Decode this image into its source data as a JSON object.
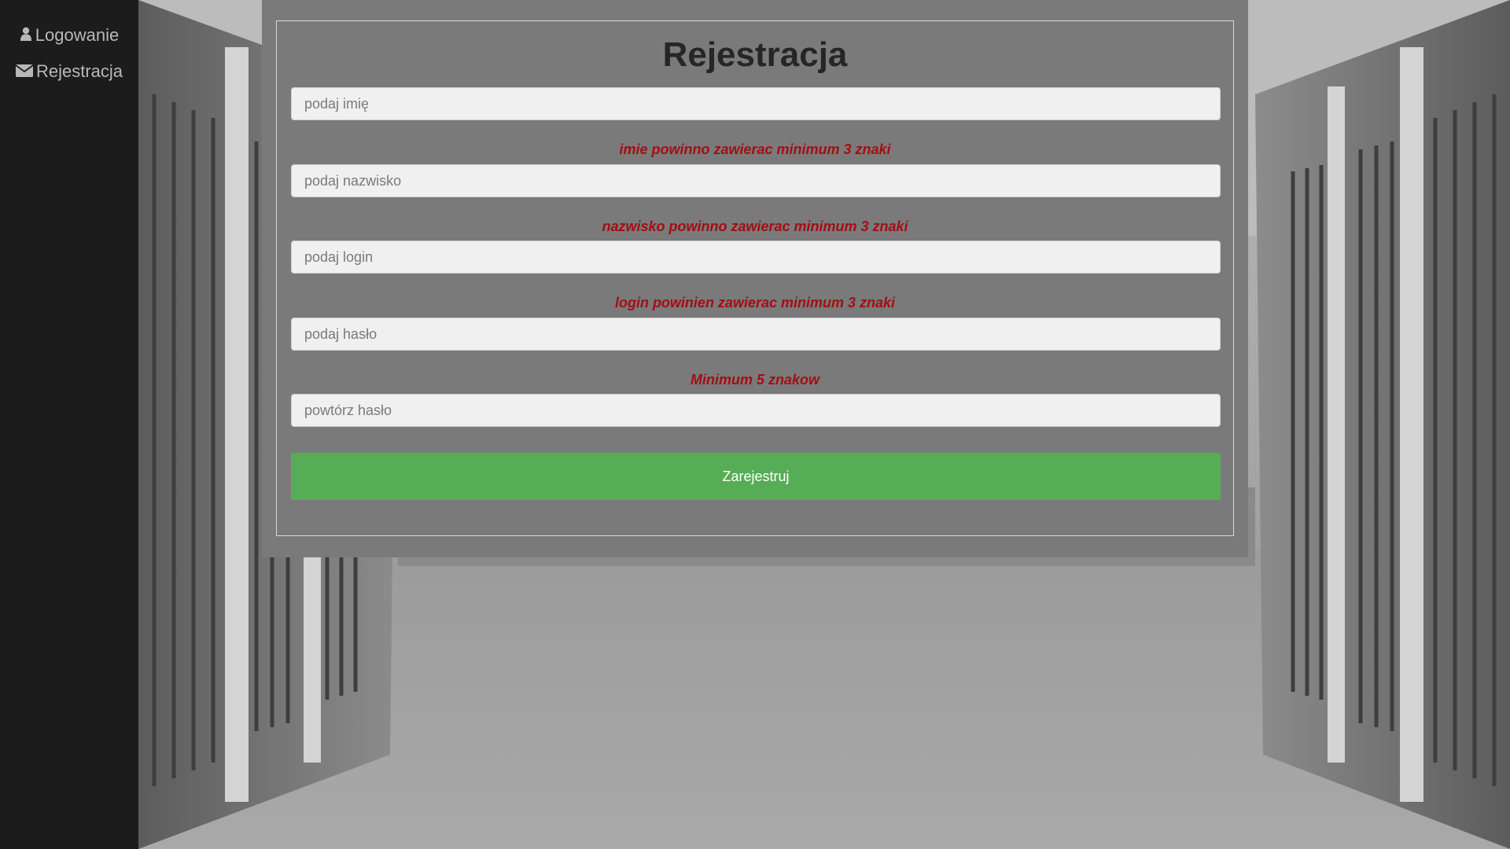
{
  "nav": {
    "items": [
      {
        "label": "Logowanie",
        "icon": "user-icon"
      },
      {
        "label": "Rejestracja",
        "icon": "envelope-icon"
      }
    ]
  },
  "form": {
    "title": "Rejestracja",
    "fields": [
      {
        "placeholder": "podaj imię",
        "error": "imie powinno zawierac minimum 3 znaki"
      },
      {
        "placeholder": "podaj nazwisko",
        "error": "nazwisko powinno zawierac minimum 3 znaki"
      },
      {
        "placeholder": "podaj login",
        "error": "login powinien zawierac minimum 3 znaki"
      },
      {
        "placeholder": "podaj hasło",
        "error": "Minimum 5 znakow"
      },
      {
        "placeholder": "powtórz hasło"
      }
    ],
    "submit_label": "Zarejestruj"
  },
  "colors": {
    "sidebar_bg": "#1c1c1c",
    "panel_bg": "#7a7a7a",
    "error": "#a30e14",
    "submit": "#56ad56"
  }
}
